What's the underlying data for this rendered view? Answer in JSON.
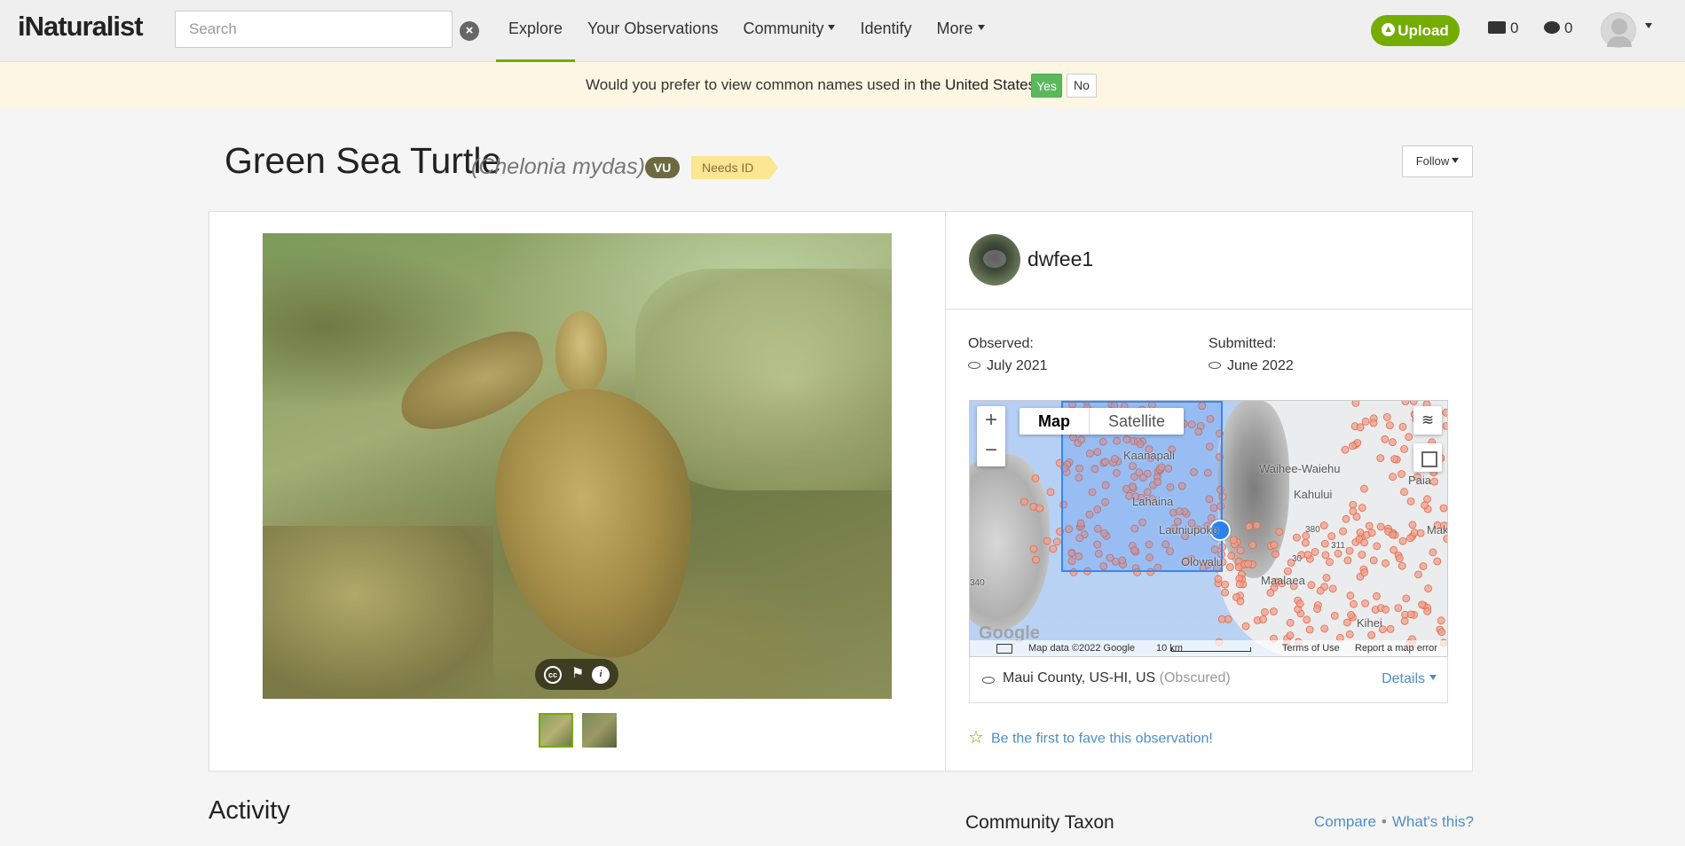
{
  "header": {
    "logo": "iNaturalist",
    "search_placeholder": "Search",
    "nav": [
      "Explore",
      "Your Observations",
      "Community",
      "Identify",
      "More"
    ],
    "upload_label": "Upload",
    "messages_count": "0",
    "notifications_count": "0"
  },
  "banner": {
    "text_prefix": "Would you prefer to view common names used in ",
    "place": "the United States",
    "text_suffix": "?",
    "yes_label": "Yes",
    "no_label": "No"
  },
  "taxon": {
    "common_name": "Green Sea Turtle",
    "scientific_name": "Chelonia mydas",
    "status_badge": "VU",
    "quality_grade": "Needs ID",
    "follow_label": "Follow"
  },
  "observer": {
    "username": "dwfee1"
  },
  "observation": {
    "observed_label": "Observed:",
    "observed_date": "July 2021",
    "submitted_label": "Submitted:",
    "submitted_date": "June 2022"
  },
  "map": {
    "type_map": "Map",
    "type_satellite": "Satellite",
    "zoom_in": "+",
    "zoom_out": "−",
    "labels": [
      "Waihee-Waiehu",
      "Kahului",
      "Lahaina",
      "Kaanapali",
      "Launiupoko",
      "Olowalu",
      "Maalaea",
      "Kihei",
      "Paia",
      "Makawao",
      "340",
      "380",
      "311",
      "30"
    ],
    "footer": {
      "google": "Google",
      "map_data": "Map data ©2022 Google",
      "scale": "10 km",
      "terms": "Terms of Use",
      "report": "Report a map error"
    }
  },
  "location": {
    "place": "Maui County, US-HI, US",
    "obscured": "(Obscured)",
    "details_label": "Details"
  },
  "fave": {
    "text": "Be the first to fave this observation!"
  },
  "sections": {
    "activity": "Activity",
    "community_taxon": "Community Taxon",
    "compare": "Compare",
    "whats_this": "What's this?"
  },
  "colors": {
    "brand_green": "#74ac00",
    "link_blue": "#4d8fc7",
    "banner_bg": "#fcf6e2",
    "yes_green": "#5cb85c",
    "vu_badge": "#6d6a42",
    "needs_id": "#fbe691"
  }
}
